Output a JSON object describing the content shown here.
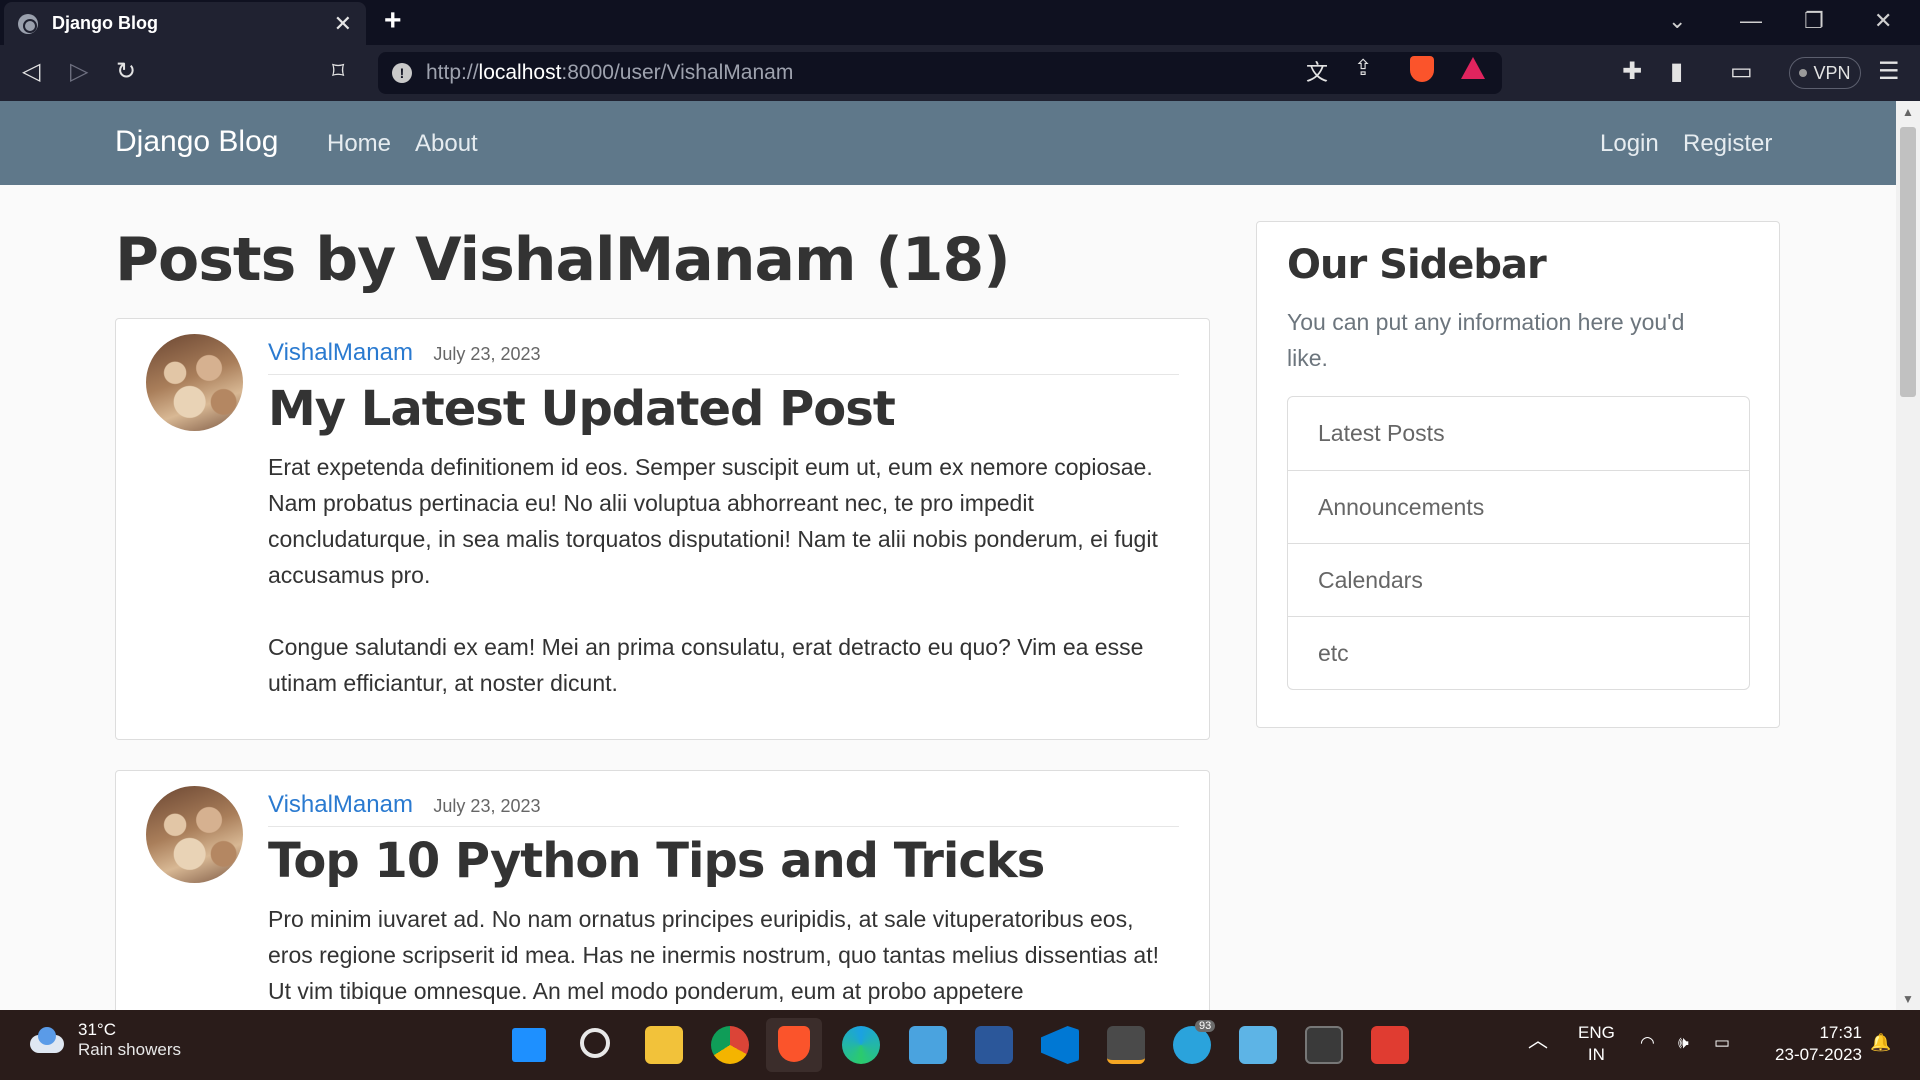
{
  "browser": {
    "tab_title": "Django Blog",
    "tab_close": "✕",
    "new_tab": "+",
    "url_prefix": "http://",
    "url_host": "localhost",
    "url_rest": ":8000/user/VishalManam",
    "vpn_label": "VPN"
  },
  "navbar": {
    "brand": "Django Blog",
    "links": [
      "Home",
      "About"
    ],
    "right_links": [
      "Login",
      "Register"
    ]
  },
  "main": {
    "heading": "Posts by VishalManam (18)",
    "posts": [
      {
        "author": "VishalManam",
        "date": "July 23, 2023",
        "title": "My Latest Updated Post",
        "paragraphs": [
          "Erat expetenda definitionem id eos. Semper suscipit eum ut, eum ex nemore copiosae. Nam probatus pertinacia eu! No alii voluptua abhorreant nec, te pro impedit concludaturque, in sea malis torquatos disputationi! Nam te alii nobis ponderum, ei fugit accusamus pro.",
          "Congue salutandi ex eam! Mei an prima consulatu, erat detracto eu quo? Vim ea esse utinam efficiantur, at noster dicunt."
        ]
      },
      {
        "author": "VishalManam",
        "date": "July 23, 2023",
        "title": "Top 10 Python Tips and Tricks",
        "paragraphs": [
          "Pro minim iuvaret ad. No nam ornatus principes euripidis, at sale vituperatoribus eos, eros regione scripserit id mea. Has ne inermis nostrum, quo tantas melius dissentias at! Ut vim tibique omnesque. An mel modo ponderum, eum at probo appetere"
        ]
      }
    ]
  },
  "sidebar": {
    "title": "Our Sidebar",
    "description": "You can put any information here you'd like.",
    "items": [
      "Latest Posts",
      "Announcements",
      "Calendars",
      "etc"
    ]
  },
  "taskbar": {
    "weather_temp": "31°C",
    "weather_desc": "Rain showers",
    "lang_line1": "ENG",
    "lang_line2": "IN",
    "time": "17:31",
    "date": "23-07-2023",
    "telegram_badge": "93"
  },
  "colors": {
    "navbar": "#5f788a",
    "link": "#2a7ad0",
    "chrome_dark": "#0f1120"
  }
}
